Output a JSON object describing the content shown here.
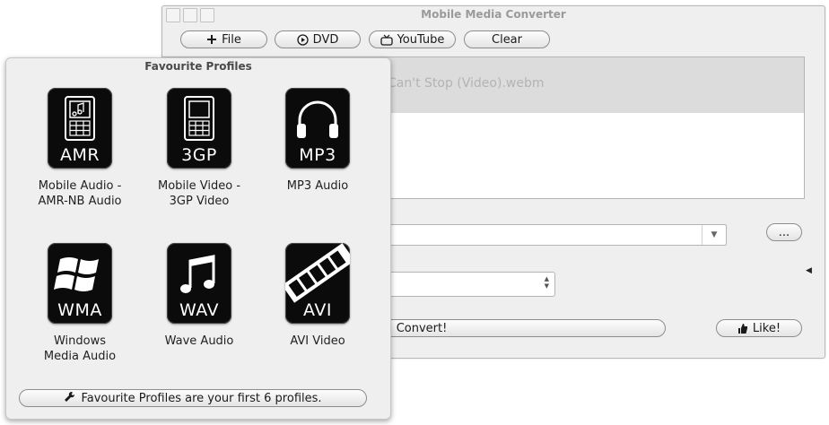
{
  "window": {
    "title": "Mobile Media Converter"
  },
  "toolbar": {
    "file_label": "File",
    "dvd_label": "DVD",
    "youtube_label": "YouTube",
    "clear_label": "Clear"
  },
  "file_list": {
    "items": [
      {
        "name": "Can't Stop (Video).webm",
        "selected": true
      }
    ]
  },
  "output": {
    "browse_label": "...",
    "convert_label": "Convert!",
    "like_label": "Like!"
  },
  "favourites": {
    "title": "Favourite Profiles",
    "note": "Favourite Profiles are your first 6 profiles.",
    "profiles": [
      {
        "badge": "AMR",
        "line1": "Mobile Audio -",
        "line2": "AMR-NB Audio",
        "icon": "phone-music-icon"
      },
      {
        "badge": "3GP",
        "line1": "Mobile Video -",
        "line2": "3GP Video",
        "icon": "phone-icon"
      },
      {
        "badge": "MP3",
        "line1": "MP3 Audio",
        "line2": "",
        "icon": "headphones-icon"
      },
      {
        "badge": "WMA",
        "line1": "Windows",
        "line2": "Media Audio",
        "icon": "windows-logo-icon"
      },
      {
        "badge": "WAV",
        "line1": "Wave Audio",
        "line2": "",
        "icon": "music-note-icon"
      },
      {
        "badge": "AVI",
        "line1": "AVI Video",
        "line2": "",
        "icon": "film-strip-icon"
      }
    ]
  },
  "colors": {
    "selection_row": "#dcdcdc",
    "icon_bg": "#0b0b0b",
    "window_bg": "#efefef"
  }
}
